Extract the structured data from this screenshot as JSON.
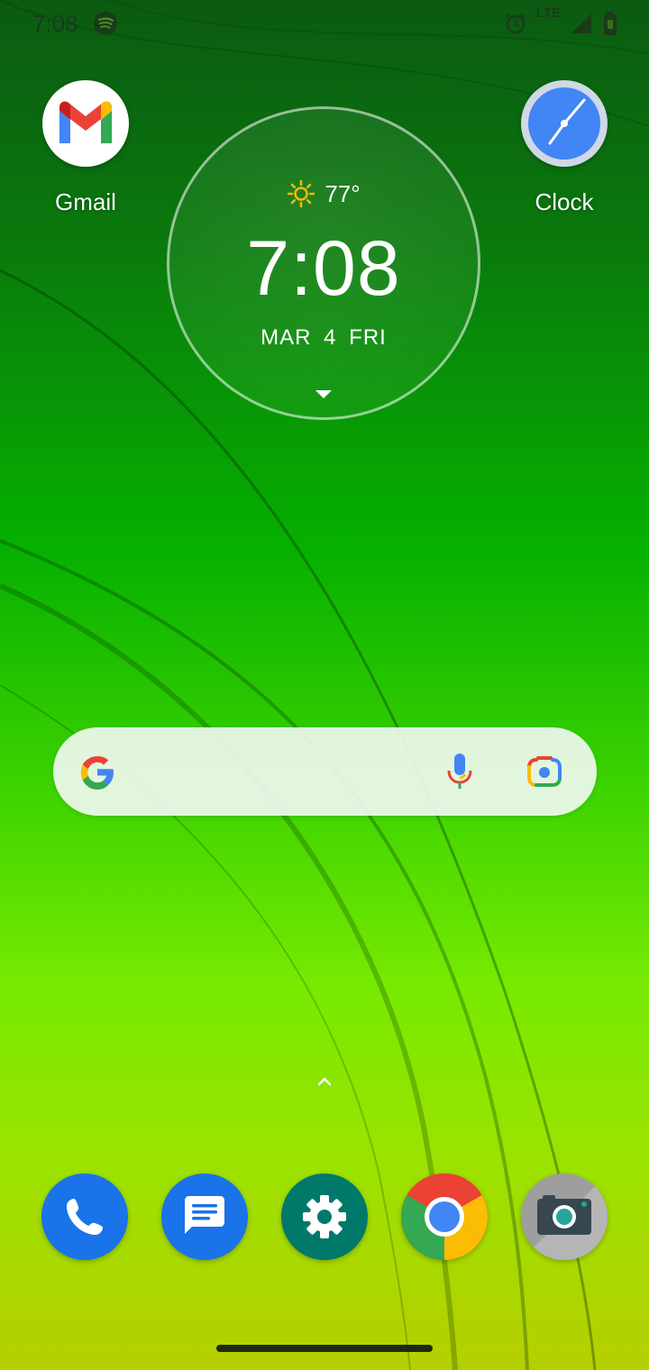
{
  "status_bar": {
    "time": "7:08",
    "network": "LTE",
    "notification_icons": [
      "spotify-icon"
    ],
    "system_icons": [
      "alarm-icon",
      "signal-icon",
      "battery-icon"
    ]
  },
  "apps": {
    "gmail": {
      "label": "Gmail",
      "icon": "gmail-icon"
    },
    "clock": {
      "label": "Clock",
      "icon": "clock-icon"
    }
  },
  "clock_widget": {
    "weather_icon": "sun-icon",
    "temperature": "77°",
    "time": "7:08",
    "date": "MAR 4 FRI"
  },
  "search_bar": {
    "icons": [
      "google-g-icon",
      "microphone-icon",
      "google-lens-icon"
    ]
  },
  "dock": [
    {
      "name": "phone",
      "icon": "phone-icon",
      "color": "#1a73e8"
    },
    {
      "name": "messages",
      "icon": "messages-icon",
      "color": "#1a73e8"
    },
    {
      "name": "settings",
      "icon": "settings-gear-icon",
      "color": "#00796b"
    },
    {
      "name": "chrome",
      "icon": "chrome-icon",
      "color": "#ea4335"
    },
    {
      "name": "camera",
      "icon": "camera-icon",
      "color": "#9e9e9e"
    }
  ],
  "colors": {
    "wallpaper_top": "#0b5a12",
    "wallpaper_bottom": "#b6cf00",
    "search_bar_bg": "#f0f8f0"
  }
}
